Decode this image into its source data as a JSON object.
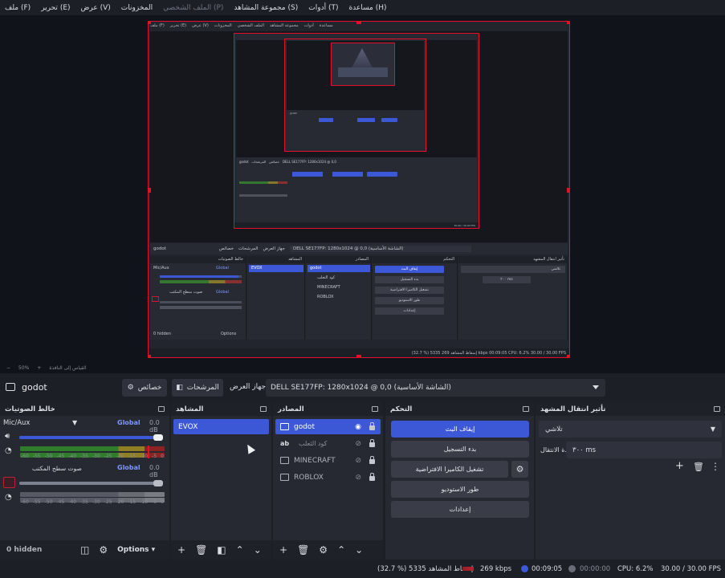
{
  "menu": [
    {
      "label": "ملف (F)"
    },
    {
      "label": "تحرير (E)"
    },
    {
      "label": "عرض (V)"
    },
    {
      "label": "المخزونات"
    },
    {
      "label": "الملف الشخصي (P)",
      "dim": true
    },
    {
      "label": "مجموعة المشاهد (S)"
    },
    {
      "label": "أدوات (T)"
    },
    {
      "label": "مساعدة (H)"
    }
  ],
  "preview": {
    "zoom": "50%",
    "scale_mode": "القياس إلى النافذة",
    "nested": {
      "source_name": "godot",
      "properties": "خصائص",
      "filters": "المرشحات",
      "display_label": "جهاز العرض",
      "display_value": "DELL SE177FP: 1280x1024 @ 0,0 (الشاشة الأساسية)",
      "mixer_title": "خالط الصوتيات",
      "scenes_title": "المشاهد",
      "sources_title": "المصادر",
      "controls_title": "التحكم",
      "transition_title": "تأثير انتقال المشهد",
      "scene": "EVOX",
      "sources": [
        "godot",
        "كود الثعلب",
        "MINECRAFT",
        "ROBLOX"
      ],
      "controls": [
        "إيقاف البث",
        "بدء التسجيل",
        "تشغيل الكاميرا الافتراضية",
        "طور الاستوديو",
        "إعدادات"
      ],
      "transition": "تلاشي",
      "duration": "٣٠٠ ms",
      "hidden": "0 hidden",
      "options": "Options",
      "status": "(32.7 %) 5335 إسقاط المشاهد    269 kbps    00:09:05    CPU: 6.2%    30.00 / 30.00 FPS"
    }
  },
  "source_toolbar": {
    "source_name": "godot",
    "properties_label": "خصائص",
    "filters_label": "المرشحات",
    "display_label": "جهاز العرض",
    "display_value": "DELL SE177FP: 1280x1024 @ 0,0 (الشاشة الأساسية)"
  },
  "mixer": {
    "title": "خالط الصوتيات",
    "channels": [
      {
        "name": "Mic/Aux",
        "scope": "Global",
        "db": "0.0 dB",
        "level": 0.97
      },
      {
        "name": "صوت سطح المكتب",
        "scope": "Global",
        "db": "0.0 dB",
        "level": 0.97
      }
    ],
    "scale": [
      "-60",
      "-55",
      "-50",
      "-45",
      "-40",
      "-35",
      "-30",
      "-25",
      "-20",
      "-15",
      "-10",
      "-5",
      "0"
    ],
    "hidden": "0 hidden",
    "options": "Options"
  },
  "scenes": {
    "title": "المشاهد",
    "items": [
      {
        "label": "EVOX",
        "selected": true
      }
    ]
  },
  "sources": {
    "title": "المصادر",
    "items": [
      {
        "label": "godot",
        "icon": "monitor",
        "selected": true,
        "visible": true
      },
      {
        "label": "ab",
        "icon": "text",
        "sub": "كود الثعلب",
        "visible": false
      },
      {
        "label": "MINECRAFT",
        "icon": "window",
        "visible": false
      },
      {
        "label": "ROBLOX",
        "icon": "window",
        "visible": false
      }
    ]
  },
  "controls": {
    "title": "التحكم",
    "buttons": [
      "إيقاف البث",
      "بدء التسجيل",
      "تشغيل الكاميرا الافتراضية",
      "طور الاستوديو",
      "إعدادات"
    ]
  },
  "transitions": {
    "title": "تأثير انتقال المشهد",
    "type": "تلاشي",
    "duration_label": "مدة الانتقال",
    "duration": "٣٠٠ ms"
  },
  "status": {
    "dropped": "(32.7 %) 5335 إسقاط المشاهد",
    "bitrate": "269 kbps",
    "stream_time": "00:09:05",
    "record_time": "00:00:00",
    "cpu": "CPU: 6.2%",
    "fps": "30.00 / 30.00 FPS"
  },
  "colors": {
    "accent": "#3c58d6",
    "selection_border": "#e3102c",
    "background": "#1d1f26",
    "panel": "#262932"
  }
}
